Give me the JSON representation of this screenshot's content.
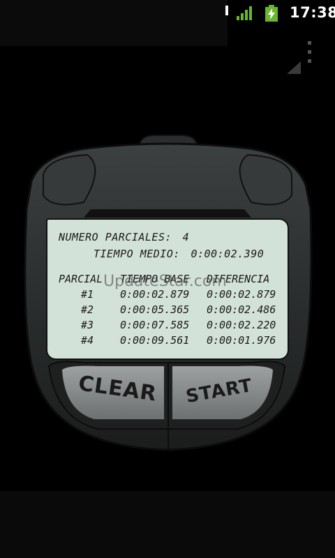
{
  "status_bar": {
    "time": "17:38",
    "icons": [
      "notification-icon",
      "signal-icon",
      "battery-charging-icon"
    ],
    "colors": {
      "signal": "#6ab72e",
      "battery": "#6ab72e"
    }
  },
  "lcd": {
    "splits_label": "NUMERO PARCIALES:",
    "splits_count": "4",
    "avg_label": "TIEMPO MEDIO:",
    "avg_value": "0:00:02.390",
    "table": {
      "columns": [
        "PARCIAL",
        "TIEMPO BASE",
        "DIFERENCIA"
      ],
      "rows": [
        {
          "id": "#1",
          "time": "0:00:02.879",
          "diff": "0:00:02.879"
        },
        {
          "id": "#2",
          "time": "0:00:05.365",
          "diff": "0:00:02.486"
        },
        {
          "id": "#3",
          "time": "0:00:07.585",
          "diff": "0:00:02.220"
        },
        {
          "id": "#4",
          "time": "0:00:09.561",
          "diff": "0:00:01.976"
        }
      ]
    },
    "colors": {
      "background": "#d3e2d8",
      "text": "#1a1a1a"
    }
  },
  "watermark": "UpdateStar.com",
  "buttons": {
    "clear_label": "CLEAR",
    "start_label": "START"
  },
  "menu": {
    "icon": "overflow-menu-icon"
  }
}
